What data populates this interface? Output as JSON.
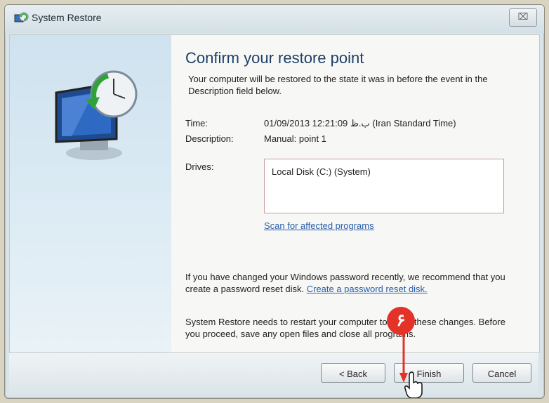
{
  "window": {
    "title": "System Restore",
    "close_glyph": "⌧"
  },
  "content": {
    "heading": "Confirm your restore point",
    "intro": "Your computer will be restored to the state it was in before the event in the Description field below.",
    "time_label": "Time:",
    "time_value": "01/09/2013 12:21:09 ب.ظ (Iran Standard Time)",
    "description_label": "Description:",
    "description_value": "Manual: point 1",
    "drives_label": "Drives:",
    "drives": [
      "Local Disk (C:) (System)"
    ],
    "scan_link": "Scan for affected programs",
    "password_text": "If you have changed your Windows password recently, we recommend that you create a password reset disk.",
    "password_link": "Create a password reset disk.",
    "restart_text": "System Restore needs to restart your computer to apply these changes. Before you proceed, save any open files and close all programs."
  },
  "buttons": {
    "back": "< Back",
    "finish": "Finish",
    "cancel": "Cancel"
  },
  "annotation": {
    "step_number": "۶"
  },
  "colors": {
    "heading": "#1c3f67",
    "link": "#2b5faa",
    "badge": "#e33228"
  },
  "icons": {
    "app": "system-restore-icon",
    "sidebar": "restore-computer-clock-icon",
    "cursor": "hand-cursor-icon"
  }
}
